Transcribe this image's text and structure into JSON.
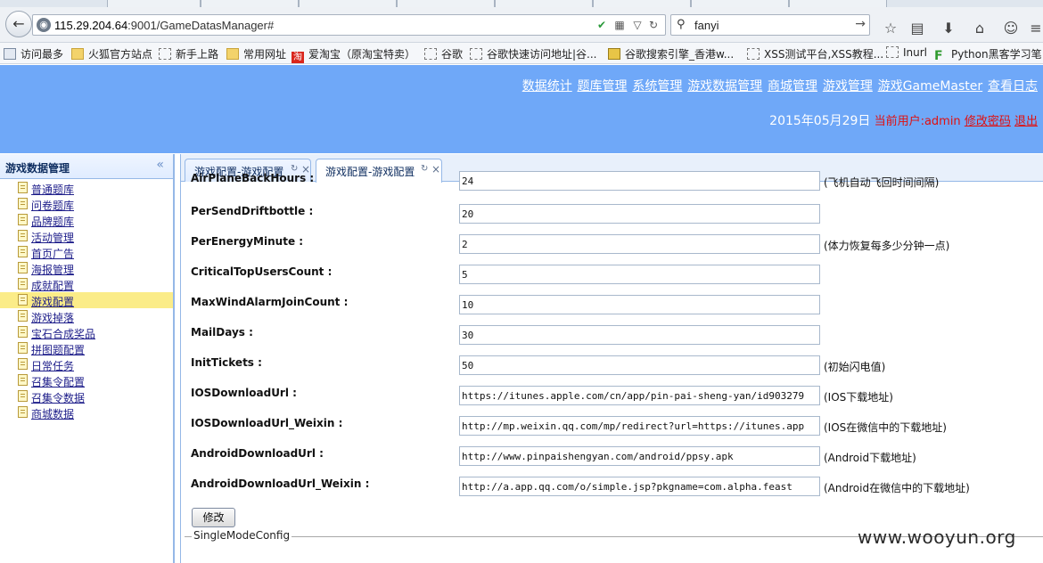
{
  "browser": {
    "url_host": "115.29.204.64",
    "url_rest": ":9001/GameDatasManager#",
    "search_query": "fanyi",
    "bookmarks": [
      {
        "label": "访问最多",
        "icon": "most-visited-icon"
      },
      {
        "label": "火狐官方站点",
        "icon": "folder-icon"
      },
      {
        "label": "新手上路",
        "icon": "page-icon"
      },
      {
        "label": "常用网址",
        "icon": "folder-icon"
      },
      {
        "label": "爱淘宝（原淘宝特卖）",
        "icon": "taobao-icon"
      },
      {
        "label": "谷歌",
        "icon": "page-icon"
      },
      {
        "label": "谷歌快速访问地址|谷...",
        "icon": "page-icon"
      },
      {
        "label": "谷歌搜索引擎_香港w...",
        "icon": "google-icon"
      },
      {
        "label": "XSS测试平台,XSS教程...",
        "icon": "page-icon"
      },
      {
        "label": "Inurl",
        "icon": "page-icon"
      },
      {
        "label": "Python黑客学习笔",
        "icon": "python-icon"
      }
    ],
    "taobao_glyph": "淘",
    "python_glyph": "F"
  },
  "header": {
    "nav": [
      "数据统计",
      "题库管理",
      "系统管理",
      "游戏数据管理",
      "商城管理",
      "游戏管理",
      "游戏GameMaster",
      "查看日志"
    ],
    "date": "2015年05月29日",
    "current_user_label": "当前用户:admin",
    "change_password": "修改密码",
    "logout": "退出"
  },
  "sidebar": {
    "title": "游戏数据管理",
    "collapse_glyph": "«",
    "items": [
      "普通题库",
      "问卷题库",
      "品牌题库",
      "活动管理",
      "首页广告",
      "海报管理",
      "成就配置",
      "游戏配置",
      "游戏掉落",
      "宝石合成奖品",
      "拼图题配置",
      "日常任务",
      "召集令配置",
      "召集令数据",
      "商城数据"
    ],
    "active_index": 7
  },
  "tabs": [
    {
      "label": "游戏配置-游戏配置",
      "active": false
    },
    {
      "label": "游戏配置-游戏配置",
      "active": true
    }
  ],
  "form": {
    "rows": [
      {
        "label": "AirPlaneBackHours :",
        "value": "24",
        "hint": "(飞机自动飞回时间间隔)"
      },
      {
        "label": "PerSendDriftbottle :",
        "value": "20",
        "hint": ""
      },
      {
        "label": "PerEnergyMinute :",
        "value": "2",
        "hint": "(体力恢复每多少分钟一点)"
      },
      {
        "label": "CriticalTopUsersCount :",
        "value": "5",
        "hint": ""
      },
      {
        "label": "MaxWindAlarmJoinCount :",
        "value": "10",
        "hint": ""
      },
      {
        "label": "MailDays :",
        "value": "30",
        "hint": ""
      },
      {
        "label": "InitTickets :",
        "value": "50",
        "hint": "(初始闪电值)"
      },
      {
        "label": "IOSDownloadUrl :",
        "value": "https://itunes.apple.com/cn/app/pin-pai-sheng-yan/id903279",
        "hint": "(IOS下载地址)"
      },
      {
        "label": "IOSDownloadUrl_Weixin :",
        "value": "http://mp.weixin.qq.com/mp/redirect?url=https://itunes.app",
        "hint": "(IOS在微信中的下载地址)"
      },
      {
        "label": "AndroidDownloadUrl :",
        "value": "http://www.pinpaishengyan.com/android/ppsy.apk",
        "hint": "(Android下载地址)"
      },
      {
        "label": "AndroidDownloadUrl_Weixin :",
        "value": "http://a.app.qq.com/o/simple.jsp?pkgname=com.alpha.feast",
        "hint": "(Android在微信中的下载地址)"
      }
    ],
    "submit_label": "修改",
    "section_legend": "SingleModeConfig"
  },
  "watermark": "www.wooyun.org",
  "glyphs": {
    "back": "←",
    "globe": "◉",
    "refresh_small": "↻",
    "close": "×",
    "search": "⚲",
    "go": "→",
    "star": "☆",
    "list": "▤",
    "download": "⬇",
    "home": "⌂",
    "chat": "☺",
    "menu": "≡",
    "qr": "▦",
    "dropdown": "▽"
  }
}
